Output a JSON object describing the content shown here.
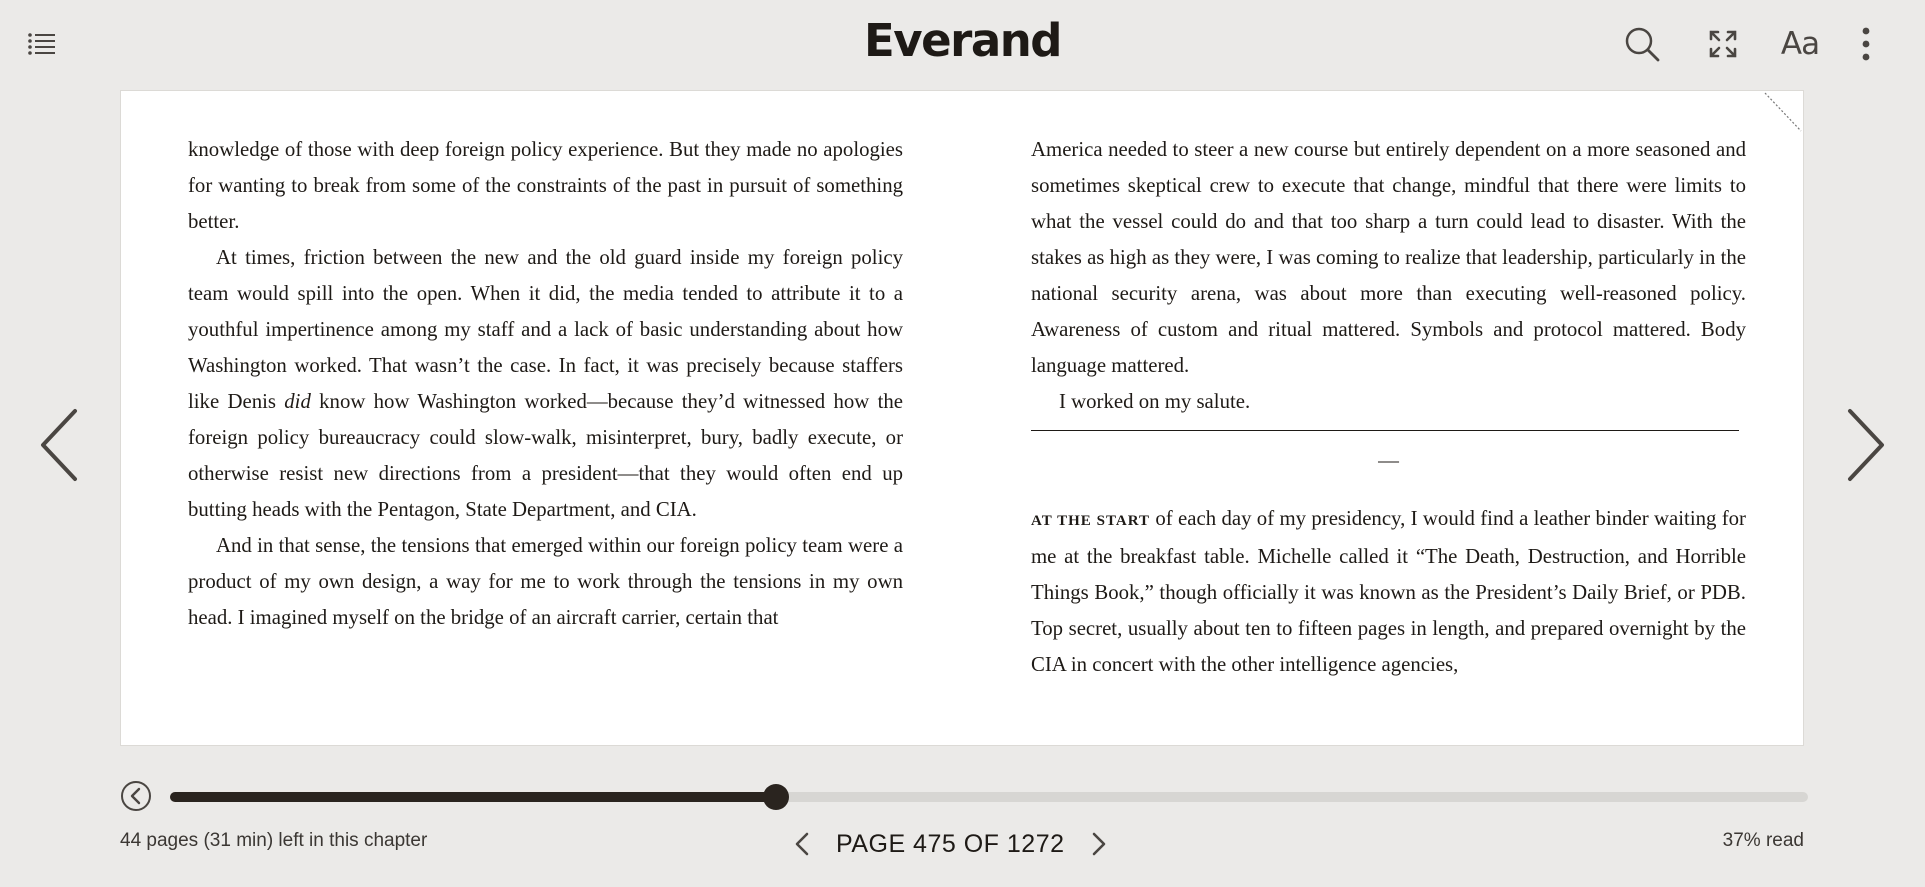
{
  "app": {
    "title": "Everand"
  },
  "toolbar": {
    "toc_icon": "list-icon",
    "search_icon": "search-icon",
    "fullscreen_icon": "fullscreen-icon",
    "font_label": "Aa",
    "more_icon": "more-vertical-icon"
  },
  "book": {
    "left_column": {
      "p1": "knowledge of those with deep foreign policy experience. But they made no apologies for wanting to break from some of the constraints of the past in pursuit of something better.",
      "p2": "At times, friction between the new and the old guard inside my foreign policy team would spill into the open. When it did, the media tended to attribute it to a youthful impertinence among my staff and a lack of basic understanding about how Washington worked. That wasn’t the case. In fact, it was precisely because staffers like Denis ",
      "p2_em": "did",
      "p2_rest": " know how Washington worked—because they’d witnessed how the foreign policy bureaucracy could slow-walk, misinterpret, bury, badly execute, or otherwise resist new directions from a president—that they would often end up butting heads with the Pentagon, State Department, and CIA.",
      "p3": "And in that sense, the tensions that emerged within our foreign policy team were a product of my own design, a way for me to work through the tensions in my own head. I imagined myself on the bridge of an aircraft carrier, certain that"
    },
    "right_column": {
      "p1": "America needed to steer a new course but entirely dependent on a more seasoned and sometimes skeptical crew to execute that change, mindful that there were limits to what the vessel could do and that too sharp a turn could lead to disaster. With the stakes as high as they were, I was coming to realize that leadership, particularly in the national security arena, was about more than executing well-reasoned policy. Awareness of custom and ritual mattered. Symbols and protocol mattered. Body language mattered.",
      "p2": "I worked on my salute.",
      "divider": "—",
      "p3_lead": "AT THE START",
      "p3": " of each day of my presidency, I would find a leather binder waiting for me at the breakfast table. Michelle called it “The Death, Destruction, and Horrible Things Book,” though officially it was known as the President’s Daily Brief, or PDB. Top secret, usually about ten to fifteen pages in length, and prepared overnight by the CIA in concert with the other intelligence agencies,"
    }
  },
  "navigation": {
    "prev_icon": "chevron-left-icon",
    "next_icon": "chevron-right-icon"
  },
  "progress": {
    "back_icon": "circle-back-icon",
    "position_fraction": 0.37,
    "chapter_remaining": "44 pages (31 min) left in this chapter",
    "page_label": "PAGE 475 OF 1272",
    "percent_read": "37% read"
  }
}
